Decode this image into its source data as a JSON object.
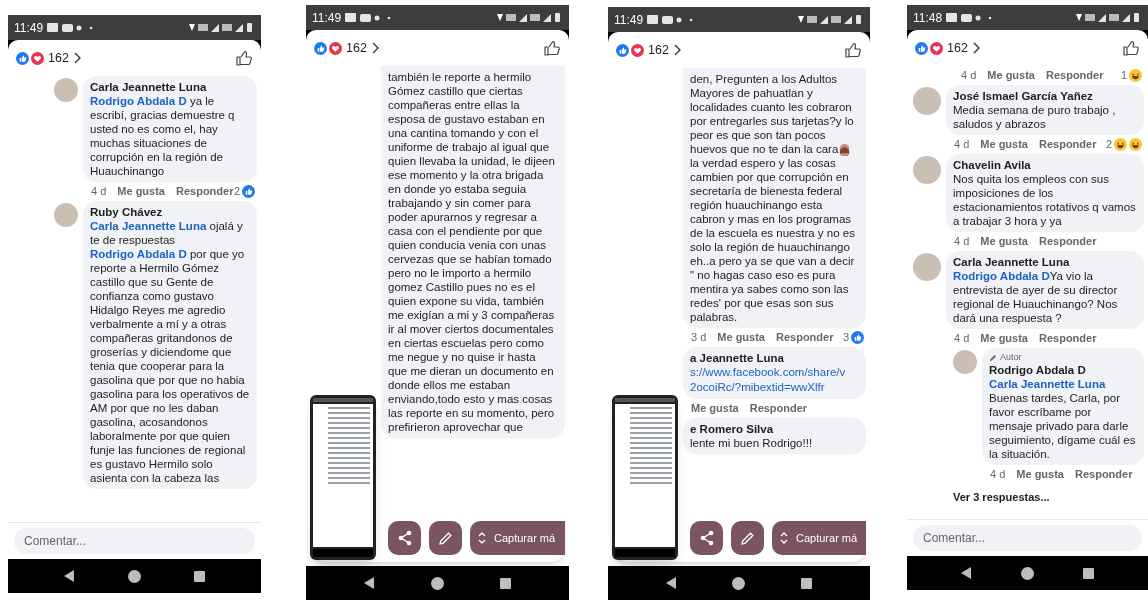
{
  "phones": [
    {
      "time": "11:49",
      "reaction_count": "162",
      "comment_field": {
        "placeholder": "Comentar..."
      },
      "items": [
        {
          "kind": "comment",
          "reply": true,
          "name": "Carla Jeannette Luna",
          "body": [
            {
              "kind": "mention",
              "text": "Rodrigo Abdala D"
            },
            {
              "kind": "text",
              "text": " ya le escribí, gracias demuestre q usted no es como el, hay muchas situaciones de corrupción en la región de Huauchinango"
            }
          ],
          "meta": {
            "age": "4 d",
            "like": "Me gusta",
            "reply": "Responder",
            "count": "2",
            "reactions": [
              {
                "kind": "like"
              }
            ]
          }
        },
        {
          "kind": "comment",
          "reply": true,
          "name": "Ruby Chávez",
          "body": [
            {
              "kind": "mention",
              "text": "Carla Jeannette Luna"
            },
            {
              "kind": "text",
              "text": " ojalá y te de respuestas "
            },
            {
              "kind": "mention",
              "text": "Rodrigo Abdala D"
            },
            {
              "kind": "text",
              "text": " por que yo reporte a Hermilo Gómez castillo que su Gente de confianza como gustavo Hidalgo Reyes me agredio verbalmente a mí y a otras compañeras gritandonos de groserías y diciendome que tenia que cooperar para la gasolina que por que no habia gasolina para los operativos de AM por que no les daban gasolina, acosandonos laboralmente por que quien funje las funciones de regional es gustavo Hermilo solo asienta con la cabeza las"
            }
          ]
        }
      ]
    },
    {
      "time": "11:49",
      "reaction_count": "162",
      "overlay": {
        "capture_label": "Capturar má"
      },
      "items": [
        {
          "kind": "continuation",
          "reply": true,
          "body": [
            {
              "kind": "text",
              "text": "también le reporte a hermilo Gómez castillo que ciertas compañeras entre ellas la esposa de gustavo estaban en una cantina tomando y con el uniforme de trabajo al igual que quien llevaba la unidad, le dijeen ese momento y la otra brigada en donde yo estaba seguia trabajando y sin comer para poder apurarnos y regresar a casa con el pendiente por que quien conducia venia con unas cervezas que se habían tomado pero no le importo a hermilo gomez Castillo pues no es el quien expone su vida, también me exigían a mi y 3 compañeras ir al mover ciertos documentales en ciertas escuelas pero como me negue y no quise ir hasta que me dieran un documento en donde ellos me estaban enviando,todo esto y mas cosas las reporte en su momento, pero prefirieron aprovechar que"
            }
          ]
        }
      ]
    },
    {
      "time": "11:49",
      "reaction_count": "162",
      "overlay": {
        "capture_label": "Capturar má"
      },
      "items": [
        {
          "kind": "continuation",
          "reply": true,
          "body": [
            {
              "kind": "text",
              "text": "den, Pregunten a los Adultos Mayores de pahuatlan y localidades cuanto les cobraron por entregarles sus tarjetas?y lo peor es que son tan pocos huevos que no te dan la cara"
            },
            {
              "kind": "emoji"
            },
            {
              "kind": "text",
              "text": " la verdad espero y las cosas cambien por que corrupción en secretaría de bienesta federal región huauchinango esta cabron y mas en los programas de la escuela es nuestra y no es solo la región de huauchinango eh..a pero ya se que van a decir \" no hagas caso eso es pura mentira ya sabes como son las redes' por que esas son sus palabras."
            }
          ],
          "meta": {
            "age": "3 d",
            "like": "Me gusta",
            "reply": "Responder",
            "count": "3",
            "reactions": [
              {
                "kind": "like"
              }
            ]
          }
        },
        {
          "kind": "comment",
          "reply": true,
          "name": "a Jeannette Luna",
          "body": [
            {
              "kind": "link",
              "text": "s://www.facebook.com/share/v"
            },
            {
              "kind": "link",
              "text": "2ocoiRc/?mibextid=wwXlfr"
            }
          ],
          "meta": {
            "like": "Me gusta",
            "reply": "Responder"
          }
        },
        {
          "kind": "comment",
          "reply": true,
          "name": "e Romero Silva",
          "body": [
            {
              "kind": "text",
              "text": "lente mi buen Rodrigo!!!"
            }
          ]
        }
      ]
    },
    {
      "time": "11:48",
      "reaction_count": "162",
      "comment_field": {
        "placeholder": "Comentar..."
      },
      "items": [
        {
          "kind": "meta",
          "meta": {
            "age": "4 d",
            "like": "Me gusta",
            "reply": "Responder",
            "count": "1",
            "reactions": [
              {
                "kind": "haha"
              }
            ]
          }
        },
        {
          "kind": "comment",
          "reply": false,
          "name": "José Ismael García Yañez",
          "body": [
            {
              "kind": "text",
              "text": "Media semana de puro trabajo , saludos y abrazos"
            }
          ],
          "meta": {
            "age": "4 d",
            "like": "Me gusta",
            "reply": "Responder",
            "count": "2",
            "reactions": [
              {
                "kind": "haha"
              },
              {
                "kind": "haha"
              }
            ]
          }
        },
        {
          "kind": "comment",
          "reply": false,
          "name": "Chavelin Avila",
          "body": [
            {
              "kind": "text",
              "text": "Nos quita los empleos con sus imposiciones de los estacionamientos rotativos q vamos a trabajar 3 hora y ya"
            }
          ],
          "meta": {
            "age": "4 d",
            "like": "Me gusta",
            "reply": "Responder"
          }
        },
        {
          "kind": "comment",
          "reply": false,
          "name": "Carla Jeannette Luna",
          "body": [
            {
              "kind": "mention",
              "text": "Rodrigo Abdala D"
            },
            {
              "kind": "text",
              "text": "Ya vio la entrevista de ayer de su director regional de Huauchinango? Nos dará una respuesta ?"
            }
          ],
          "meta": {
            "age": "4 d",
            "like": "Me gusta",
            "reply": "Responder"
          },
          "children": [
            {
              "kind": "comment",
              "reply": true,
              "badge": "Autor",
              "name": "Rodrigo Abdala D",
              "body": [
                {
                  "kind": "mention",
                  "text": "Carla Jeannette Luna"
                },
                {
                  "kind": "text",
                  "text": " Buenas tardes, Carla, por favor escríbame por mensaje privado para darle seguimiento, dígame cuál es la situación."
                }
              ],
              "meta": {
                "age": "4 d",
                "like": "Me gusta",
                "reply": "Responder"
              }
            }
          ],
          "more_replies": "Ver 3 respuestas..."
        }
      ]
    }
  ]
}
